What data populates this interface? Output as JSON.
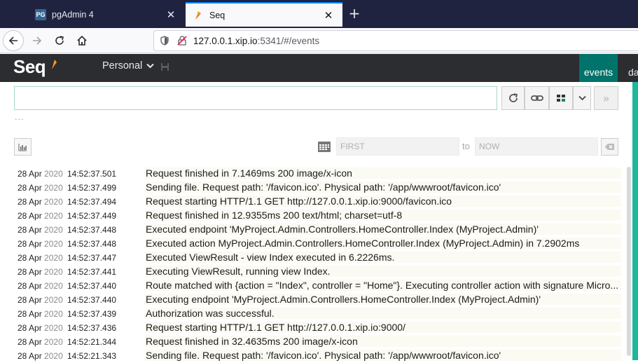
{
  "browser": {
    "tabs": [
      {
        "title": "pgAdmin 4",
        "favicon": "PG",
        "active": false
      },
      {
        "title": "Seq",
        "active": true
      }
    ],
    "url_host": "127.0.0.1.xip.io",
    "url_rest": ":5341/#/events"
  },
  "seq": {
    "logo": "Seq",
    "workspace": "Personal",
    "nav": {
      "events": "events",
      "dash": "da"
    },
    "search": {
      "placeholder": "",
      "value": ""
    },
    "ellipsis": "...",
    "date_from_placeholder": "FIRST",
    "date_to_label": "to",
    "date_to_placeholder": "NOW",
    "colors": {
      "header": "#2b2d31",
      "accent": "#00736a",
      "stripe": "#1bb99a"
    }
  },
  "events": [
    {
      "day": "28 Apr",
      "year": "2020",
      "time": "14:52:37.501",
      "message": "Request finished in 7.1469ms 200 image/x-icon"
    },
    {
      "day": "28 Apr",
      "year": "2020",
      "time": "14:52:37.499",
      "message": "Sending file. Request path: '/favicon.ico'. Physical path: '/app/wwwroot/favicon.ico'"
    },
    {
      "day": "28 Apr",
      "year": "2020",
      "time": "14:52:37.494",
      "message": "Request starting HTTP/1.1 GET http://127.0.0.1.xip.io:9000/favicon.ico"
    },
    {
      "day": "28 Apr",
      "year": "2020",
      "time": "14:52:37.449",
      "message": "Request finished in 12.9355ms 200 text/html; charset=utf-8"
    },
    {
      "day": "28 Apr",
      "year": "2020",
      "time": "14:52:37.448",
      "message": "Executed endpoint 'MyProject.Admin.Controllers.HomeController.Index (MyProject.Admin)'"
    },
    {
      "day": "28 Apr",
      "year": "2020",
      "time": "14:52:37.448",
      "message": "Executed action MyProject.Admin.Controllers.HomeController.Index (MyProject.Admin) in 7.2902ms"
    },
    {
      "day": "28 Apr",
      "year": "2020",
      "time": "14:52:37.447",
      "message": "Executed ViewResult - view Index executed in 6.2226ms."
    },
    {
      "day": "28 Apr",
      "year": "2020",
      "time": "14:52:37.441",
      "message": "Executing ViewResult, running view Index."
    },
    {
      "day": "28 Apr",
      "year": "2020",
      "time": "14:52:37.440",
      "message": "Route matched with {action = \"Index\", controller = \"Home\"}. Executing controller action with signature Micro..."
    },
    {
      "day": "28 Apr",
      "year": "2020",
      "time": "14:52:37.440",
      "message": "Executing endpoint 'MyProject.Admin.Controllers.HomeController.Index (MyProject.Admin)'"
    },
    {
      "day": "28 Apr",
      "year": "2020",
      "time": "14:52:37.439",
      "message": "Authorization was successful."
    },
    {
      "day": "28 Apr",
      "year": "2020",
      "time": "14:52:37.436",
      "message": "Request starting HTTP/1.1 GET http://127.0.0.1.xip.io:9000/"
    },
    {
      "day": "28 Apr",
      "year": "2020",
      "time": "14:52:21.344",
      "message": "Request finished in 32.4635ms 200 image/x-icon"
    },
    {
      "day": "28 Apr",
      "year": "2020",
      "time": "14:52:21.343",
      "message": "Sending file. Request path: '/favicon.ico'. Physical path: '/app/wwwroot/favicon.ico'"
    }
  ]
}
